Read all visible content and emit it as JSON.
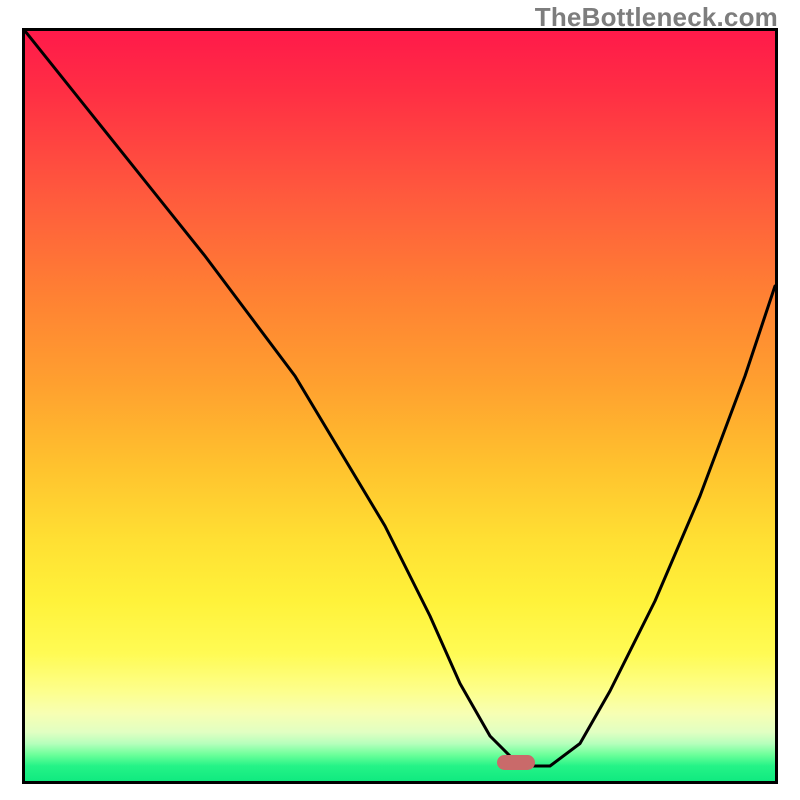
{
  "watermark": "TheBottleneck.com",
  "colors": {
    "border": "#000000",
    "curve_stroke": "#000000",
    "marker_fill": "#c96a6a",
    "watermark_text": "#7d7d7d",
    "gradient_top": "#ff1a4a",
    "gradient_mid": "#ffe033",
    "gradient_green": "#10ea80"
  },
  "marker": {
    "x_percent": 65.5,
    "y_percent": 97.5
  },
  "chart_data": {
    "type": "line",
    "title": "",
    "xlabel": "",
    "ylabel": "",
    "xlim": [
      0,
      100
    ],
    "ylim": [
      0,
      100
    ],
    "annotations": [
      {
        "text": "TheBottleneck.com",
        "position": "top-right"
      }
    ],
    "background_gradient": "red-to-green vertical (bottleneck severity)",
    "marker_point": {
      "x": 65.5,
      "y": 2.5
    },
    "series": [
      {
        "name": "bottleneck-curve",
        "x": [
          0,
          8,
          16,
          24,
          30,
          36,
          42,
          48,
          54,
          58,
          62,
          66,
          70,
          74,
          78,
          84,
          90,
          96,
          100
        ],
        "values": [
          100,
          90,
          80,
          70,
          62,
          54,
          44,
          34,
          22,
          13,
          6,
          2,
          2,
          5,
          12,
          24,
          38,
          54,
          66
        ]
      }
    ]
  }
}
